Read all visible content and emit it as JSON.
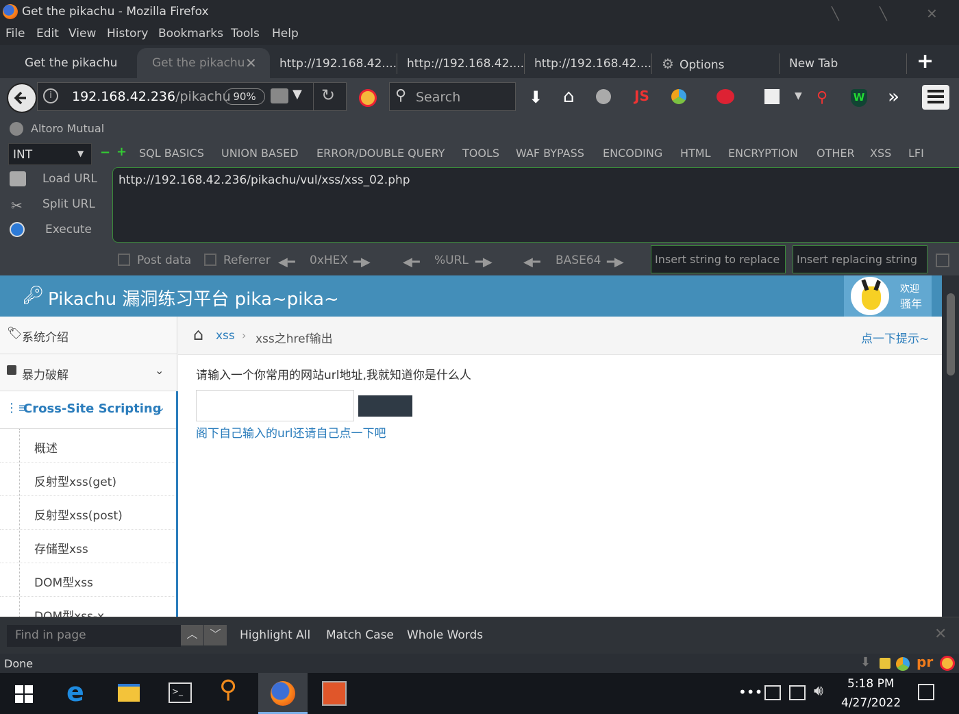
{
  "window": {
    "title": "Get the pikachu - Mozilla Firefox"
  },
  "menu": [
    "File",
    "Edit",
    "View",
    "History",
    "Bookmarks",
    "Tools",
    "Help"
  ],
  "tabs": [
    {
      "label": "Get the pikachu"
    },
    {
      "label": "Get the pikachu"
    },
    {
      "label": "http://192.168.42...."
    },
    {
      "label": "http://192.168.42...."
    },
    {
      "label": "http://192.168.42...."
    },
    {
      "label": "Options"
    },
    {
      "label": "New Tab"
    }
  ],
  "nav": {
    "url_host": "192.168.42.236",
    "url_path": "/pikachu",
    "zoom": "90%",
    "search_placeholder": "Search"
  },
  "bookmarks": {
    "item": "Altoro Mutual"
  },
  "hackbar": {
    "type_select": "INT",
    "menus": [
      "SQL BASICS",
      "UNION BASED",
      "ERROR/DOUBLE QUERY",
      "TOOLS",
      "WAF BYPASS",
      "ENCODING",
      "HTML",
      "ENCRYPTION",
      "OTHER",
      "XSS",
      "LFI"
    ],
    "load_url": "Load URL",
    "split_url": "Split URL",
    "execute": "Execute",
    "url_value": "http://192.168.42.236/pikachu/vul/xss/xss_02.php",
    "post_data": "Post data",
    "referrer": "Referrer",
    "hex": "0xHEX",
    "url_enc": "%URL",
    "base64": "BASE64",
    "replace_placeholder": "Insert string to replace",
    "replacing_placeholder": "Insert replacing string"
  },
  "site": {
    "brand": "Pikachu 漏洞练习平台 pika~pika~",
    "welcome_line1": "欢迎",
    "welcome_line2": "骚年",
    "sidebar": {
      "intro": "系统介绍",
      "brute": "暴力破解",
      "xss": "Cross-Site Scripting",
      "subitems": [
        "概述",
        "反射型xss(get)",
        "反射型xss(post)",
        "存储型xss",
        "DOM型xss",
        "DOM型xss-x"
      ]
    },
    "breadcrumb": {
      "parent": "xss",
      "current": "xss之href输出",
      "hint": "点一下提示~"
    },
    "prompt": "请输入一个你常用的网站url地址,我就知道你是什么人",
    "input_value": "",
    "result_link": "阁下自己输入的url还请自己点一下吧"
  },
  "findbar": {
    "placeholder": "Find in page",
    "highlight": "Highlight All",
    "match_case": "Match Case",
    "whole_words": "Whole Words"
  },
  "status": {
    "text": "Done"
  },
  "taskbar": {
    "time": "5:18 PM",
    "date": "4/27/2022"
  }
}
